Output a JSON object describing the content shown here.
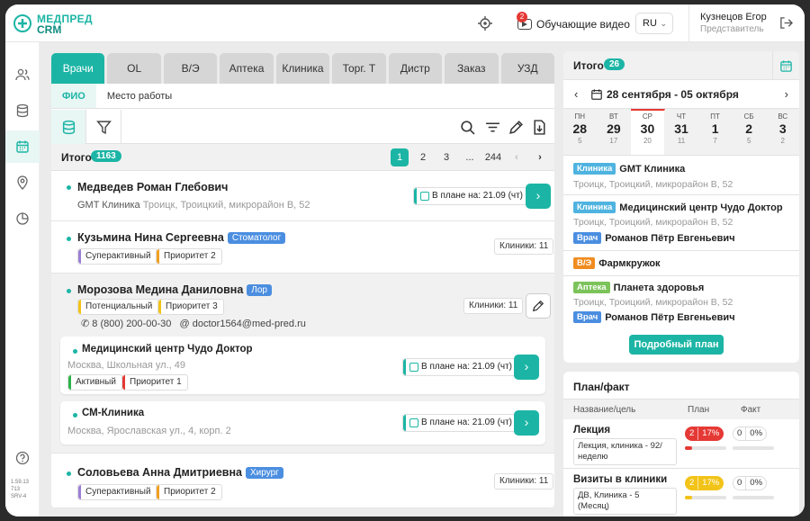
{
  "app": {
    "logo_line1": "МЕДПРЕД",
    "logo_line2": "CRM",
    "brand_color": "#1cb5a5"
  },
  "topbar": {
    "video_label": "Обучающие видео",
    "video_badge": "2",
    "lang": "RU",
    "user_name": "Кузнецов Егор",
    "user_role": "Представитель"
  },
  "sidebar": {
    "footer": [
      "1.59.13",
      "713",
      "SRV-4"
    ]
  },
  "tabs": [
    "Врачи",
    "OL",
    "В/Э",
    "Аптека",
    "Клиника",
    "Торг. Т",
    "Дистр",
    "Заказ",
    "УЗД"
  ],
  "subtabs": [
    "ФИО",
    "Место работы"
  ],
  "list": {
    "total_label": "Итого",
    "total_count": "1163",
    "pages": [
      "1",
      "2",
      "3",
      "...",
      "244"
    ],
    "doctors": [
      {
        "name": "Медведев Роман Глебович",
        "org": "GMT Клиника",
        "address": "Троицк, Троицкий, микрорайон В, 52",
        "plan": "В плане на: 21.09 (чт)"
      },
      {
        "name": "Кузьмина Нина Сергеевна",
        "spec": "Стоматолог",
        "chips": [
          "Суперактивный",
          "Приоритет 2"
        ],
        "clinics": "Клиники: 11"
      },
      {
        "name": "Морозова Медина Даниловна",
        "spec": "Лор",
        "chips": [
          "Потенциальный",
          "Приоритет 3"
        ],
        "clinics": "Клиники: 11",
        "phone": "8 (800) 200-00-30",
        "email": "doctor1564@med-pred.ru",
        "workplaces": [
          {
            "name": "Медицинский центр Чудо Доктор",
            "address": "Москва, Школьная ул., 49",
            "chips": [
              "Активный",
              "Приоритет 1"
            ],
            "plan": "В плане на: 21.09 (чт)"
          },
          {
            "name": "СМ-Клиника",
            "address": "Москва, Ярославская ул., 4, корп. 2",
            "plan": "В плане на: 21.09 (чт)"
          }
        ]
      },
      {
        "name": "Соловьева Анна Дмитриевна",
        "spec": "Хирург",
        "chips": [
          "Суперактивный",
          "Приоритет 2"
        ],
        "clinics": "Клиники: 11"
      }
    ]
  },
  "schedule": {
    "title": "Итого",
    "count": "26",
    "week": "28 сентября - 05 октября",
    "days": [
      {
        "d": "ПН",
        "n": "28",
        "c": "5"
      },
      {
        "d": "ВТ",
        "n": "29",
        "c": "17"
      },
      {
        "d": "СР",
        "n": "30",
        "c": "20"
      },
      {
        "d": "ЧТ",
        "n": "31",
        "c": "11"
      },
      {
        "d": "ПТ",
        "n": "1",
        "c": "7"
      },
      {
        "d": "СБ",
        "n": "2",
        "c": "5"
      },
      {
        "d": "ВС",
        "n": "3",
        "c": "2"
      }
    ],
    "events": [
      {
        "tag": "Клиника",
        "name": "GMT Клиника",
        "address": "Троицк, Троицкий, микрорайон В, 52"
      },
      {
        "tag": "Клиника",
        "name": "Медицинский центр Чудо Доктор",
        "address": "Троицк, Троицкий, микрорайон В, 52",
        "tag2": "Врач",
        "name2": "Романов Пётр Евгеньевич"
      },
      {
        "tag": "В/Э",
        "name": "Фармкружок"
      },
      {
        "tag": "Аптека",
        "name": "Планета здоровья",
        "address": "Троицк, Троицкий, микрорайон В, 52",
        "tag2": "Врач",
        "name2": "Романов Пётр Евгеньевич"
      }
    ],
    "detail_button": "Подробный план"
  },
  "planfact": {
    "title": "План/факт",
    "cols": [
      "Название/цель",
      "План",
      "Факт"
    ],
    "rows": [
      {
        "name": "Лекция",
        "goal": "Лекция, клиника - 92/неделю",
        "plan": "2",
        "plan_pct": "17%",
        "plan_fraction": 0.17,
        "fact": "0",
        "fact_pct": "0%",
        "color": "#e53935"
      },
      {
        "name": "Визиты в клиники",
        "goal": "ДВ, Клиника - 5 (Месяц)",
        "plan": "2",
        "plan_pct": "17%",
        "plan_fraction": 0.17,
        "fact": "0",
        "fact_pct": "0%",
        "color": "#f2c318"
      }
    ]
  }
}
